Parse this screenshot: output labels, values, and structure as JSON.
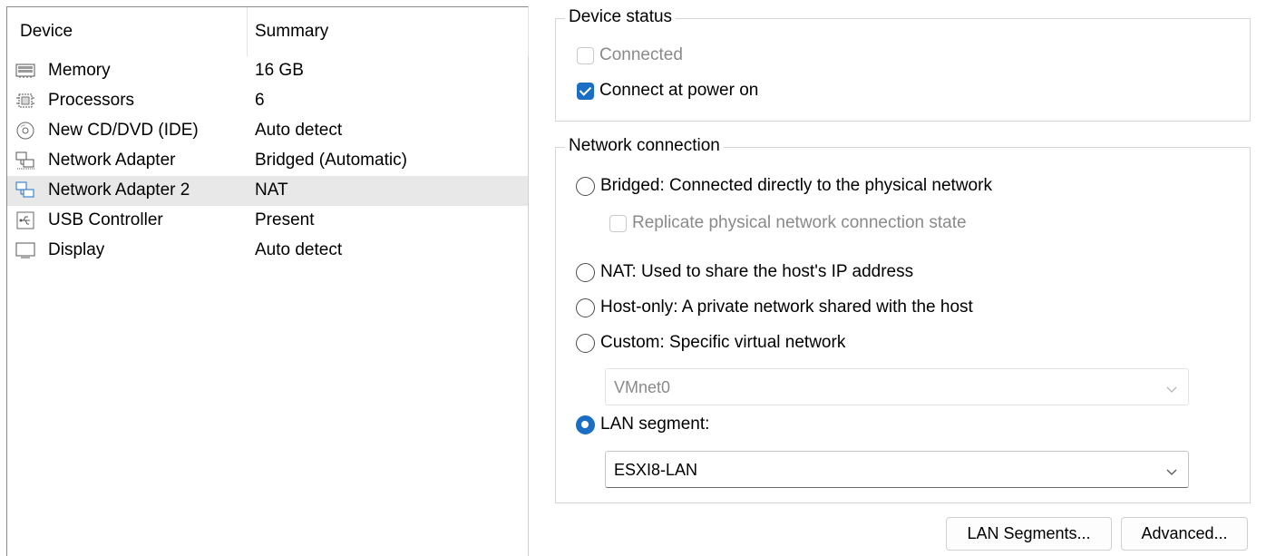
{
  "device_list": {
    "headers": {
      "device": "Device",
      "summary": "Summary"
    },
    "items": [
      {
        "name": "Memory",
        "summary": "16 GB",
        "icon": "memory-icon"
      },
      {
        "name": "Processors",
        "summary": "6",
        "icon": "processor-icon"
      },
      {
        "name": "New CD/DVD (IDE)",
        "summary": "Auto detect",
        "icon": "cd-dvd-icon"
      },
      {
        "name": "Network Adapter",
        "summary": "Bridged (Automatic)",
        "icon": "network-adapter-icon"
      },
      {
        "name": "Network Adapter 2",
        "summary": "NAT",
        "icon": "network-adapter-icon",
        "selected": true
      },
      {
        "name": "USB Controller",
        "summary": "Present",
        "icon": "usb-icon"
      },
      {
        "name": "Display",
        "summary": "Auto detect",
        "icon": "display-icon"
      }
    ]
  },
  "device_status": {
    "title": "Device status",
    "connected": {
      "label": "Connected",
      "checked": false,
      "enabled": false
    },
    "connect_at_power_on": {
      "label": "Connect at power on",
      "checked": true,
      "enabled": true
    }
  },
  "network_connection": {
    "title": "Network connection",
    "bridged": {
      "label": "Bridged: Connected directly to the physical network",
      "checked": false
    },
    "replicate": {
      "label": "Replicate physical network connection state",
      "checked": false,
      "enabled": false
    },
    "nat": {
      "label": "NAT: Used to share the host's IP address",
      "checked": false
    },
    "host_only": {
      "label": "Host-only: A private network shared with the host",
      "checked": false
    },
    "custom": {
      "label": "Custom: Specific virtual network",
      "checked": false
    },
    "custom_select": {
      "value": "VMnet0",
      "enabled": false
    },
    "lan_segment": {
      "label": "LAN segment:",
      "checked": true
    },
    "lan_select": {
      "value": "ESXI8-LAN",
      "enabled": true
    }
  },
  "buttons": {
    "lan_segments": "LAN Segments...",
    "advanced": "Advanced..."
  },
  "colors": {
    "accent": "#1a6fc4",
    "selected_row": "#e8e8e8",
    "disabled_text": "#8a8a8a"
  }
}
